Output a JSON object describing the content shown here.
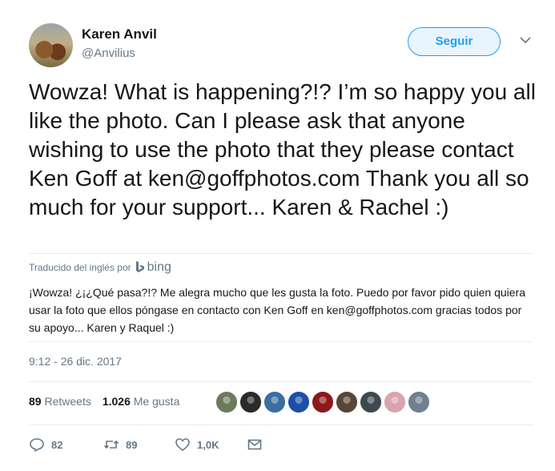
{
  "author": {
    "name": "Karen Anvil",
    "handle": "@Anvilius"
  },
  "follow_button": {
    "label": "Seguir"
  },
  "tweet": {
    "text": "Wowza! What is happening?!? I’m so happy you all like the photo. Can I please ask that anyone wishing to use the photo that they please contact Ken Goff at ken@goffphotos.com Thank you all so much for your support... Karen & Rachel :)"
  },
  "translation": {
    "label": "Traducido del inglés por",
    "provider": "bing",
    "text": "¡Wowza! ¿¡¿Qué pasa?!? Me alegra mucho que les gusta la foto. Puedo por favor pido quien quiera usar la foto que ellos póngase en contacto con Ken Goff en ken@goffphotos.com gracias todos por su apoyo... Karen y Raquel :)"
  },
  "timestamp": "9:12 - 26 dic. 2017",
  "stats": {
    "retweets_count": "89",
    "retweets_label": "Retweets",
    "likes_count": "1.026",
    "likes_label": "Me gusta"
  },
  "likers": [
    {
      "name": "liker-avatar-1",
      "color": "#6b7b5a"
    },
    {
      "name": "liker-avatar-2",
      "color": "#2a2a2a"
    },
    {
      "name": "liker-avatar-3",
      "color": "#3a6fa0"
    },
    {
      "name": "liker-avatar-4",
      "color": "#1b4fa8"
    },
    {
      "name": "liker-avatar-5",
      "color": "#8b1a1a"
    },
    {
      "name": "liker-avatar-6",
      "color": "#5a4636"
    },
    {
      "name": "liker-avatar-7",
      "color": "#3c4a50"
    },
    {
      "name": "liker-avatar-8",
      "color": "#d9a3b0"
    },
    {
      "name": "liker-avatar-9",
      "color": "#708090"
    }
  ],
  "actions": {
    "reply_count": "82",
    "retweet_count": "89",
    "like_count": "1,0K"
  },
  "colors": {
    "accent": "#1da1f2",
    "secondary_text": "#657786",
    "divider": "#e6ecf0"
  }
}
